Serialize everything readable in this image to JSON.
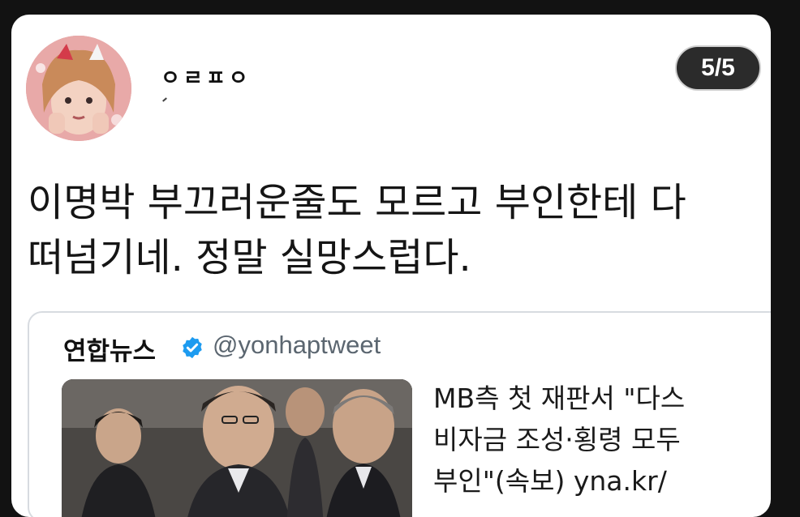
{
  "tweet": {
    "username": "ㅇㄹㅍㅇ",
    "counter": "5/5",
    "text_line1": "이명박 부끄러운줄도 모르고 부인한테 다",
    "text_line2": "떠넘기네. 정말 실망스럽다."
  },
  "quoted_tweet": {
    "name": "연합뉴스",
    "handle": "@yonhaptweet",
    "verified_icon": "verified-badge-icon",
    "headline_line1": "MB측 첫 재판서 \"다스",
    "headline_line2": "비자금 조성·횡령 모두",
    "headline_line3": "부인\"(속보) yna.kr/"
  },
  "colors": {
    "background": "#121212",
    "card": "#ffffff",
    "counter_bg": "#2b2b2b",
    "verified": "#1d9bf0",
    "handle_text": "#5b6670"
  }
}
